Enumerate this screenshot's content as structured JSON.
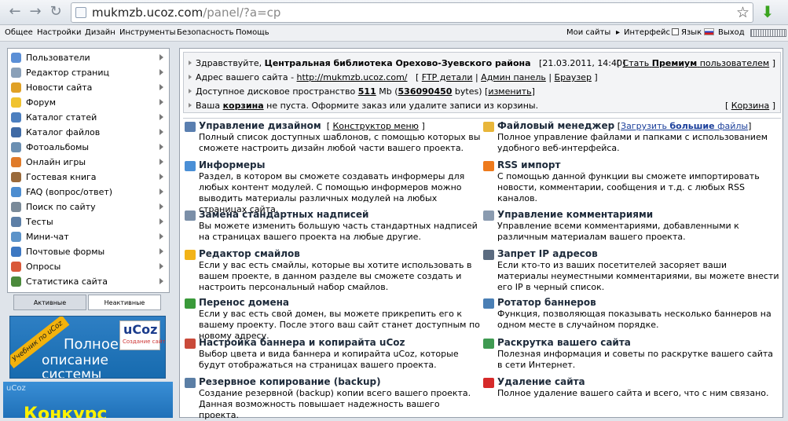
{
  "browser": {
    "url_host": "mukmzb.ucoz.com",
    "url_path": "/panel/?a=cp"
  },
  "menubar": {
    "items": [
      "Общее",
      "Настройки",
      "Дизайн",
      "Инструменты",
      "Безопасность",
      "Помощь"
    ],
    "right": {
      "my_sites": "Мои сайты",
      "interface": "Интерфейс",
      "language": "Язык",
      "logout": "Выход"
    }
  },
  "sidebar": {
    "items": [
      {
        "label": "Пользователи",
        "icon": "users-icon",
        "color": "#5b8fd6"
      },
      {
        "label": "Редактор страниц",
        "icon": "pages-icon",
        "color": "#8aa0b8"
      },
      {
        "label": "Новости сайта",
        "icon": "news-icon",
        "color": "#e0a126"
      },
      {
        "label": "Форум",
        "icon": "forum-icon",
        "color": "#f0c330"
      },
      {
        "label": "Каталог статей",
        "icon": "articles-icon",
        "color": "#4c7fbf"
      },
      {
        "label": "Каталог файлов",
        "icon": "files-icon",
        "color": "#3f6aa5"
      },
      {
        "label": "Фотоальбомы",
        "icon": "photo-icon",
        "color": "#6b8fb2"
      },
      {
        "label": "Онлайн игры",
        "icon": "games-icon",
        "color": "#e07b2a"
      },
      {
        "label": "Гостевая книга",
        "icon": "guestbook-icon",
        "color": "#9a6a3b"
      },
      {
        "label": "FAQ (вопрос/ответ)",
        "icon": "faq-icon",
        "color": "#4d8dd0"
      },
      {
        "label": "Поиск по сайту",
        "icon": "search-icon",
        "color": "#7a8a99"
      },
      {
        "label": "Тесты",
        "icon": "tests-icon",
        "color": "#5d7fa6"
      },
      {
        "label": "Мини-чат",
        "icon": "chat-icon",
        "color": "#5c93c9"
      },
      {
        "label": "Почтовые формы",
        "icon": "mail-icon",
        "color": "#3d78c2"
      },
      {
        "label": "Опросы",
        "icon": "polls-icon",
        "color": "#d9593a"
      },
      {
        "label": "Статистика сайта",
        "icon": "stats-icon",
        "color": "#4b8a3c"
      }
    ],
    "tabs": [
      "Активные",
      "Неактивные"
    ]
  },
  "banners": {
    "ribbon": "Учебник по uCoz",
    "line1": "Полное",
    "line2": "описание системы",
    "brand": "uCoz",
    "brand_sub": "Создание сайтов",
    "logo2": "uCoz",
    "big2": "Конкурс"
  },
  "info": {
    "greeting_prefix": "Здравствуйте,",
    "org_name": "Центральная библиотека Орехово-Зуевского района",
    "datetime": "[21.03.2011, 14:40]",
    "premium_open": "[",
    "premium_link": "Стать",
    "premium_word": "Премиум",
    "premium_rest": "пользователем",
    "premium_close": "]",
    "address_label": "Адрес вашего сайта -",
    "address_link": "http://mukmzb.ucoz.com/",
    "link_ftp": "FTP детали",
    "link_admin": "Админ панель",
    "link_browser": "Браузер",
    "disk_label": "Доступное дисковое пространство",
    "disk_mb": "511",
    "disk_unit": "Mb",
    "disk_bytes": "536090450",
    "disk_bytes_unit": "bytes)",
    "disk_change": "изменить",
    "cart_prefix": "Ваша",
    "cart_word": "корзина",
    "cart_rest": "не пуста. Оформите заказ или удалите записи из корзины.",
    "cart_link": "Корзина"
  },
  "modules_left": [
    {
      "title": "Управление дизайном",
      "link": "Конструктор меню",
      "desc": "Полный список доступных шаблонов, с помощью которых вы сможете настроить дизайн любой части вашего проекта.",
      "icon": "design-icon",
      "color": "#5a7fb0"
    },
    {
      "title": "Информеры",
      "desc": "Раздел, в котором вы сможете создавать информеры для любых контент модулей. С помощью информеров можно выводить материалы различных модулей на любых страницах сайта.",
      "icon": "informer-icon",
      "color": "#4a8fd6"
    },
    {
      "title": "Замена стандартных надписей",
      "desc": "Вы можете изменить большую часть стандартных надписей на страницах вашего проекта на любые другие.",
      "icon": "replace-icon",
      "color": "#7b8fa8"
    },
    {
      "title": "Редактор смайлов",
      "desc": "Если у вас есть смайлы, которые вы хотите использовать в вашем проекте, в данном разделе вы сможете создать и настроить персональный набор смайлов.",
      "icon": "smile-icon",
      "color": "#f2b318"
    },
    {
      "title": "Перенос домена",
      "desc": "Если у вас есть свой домен, вы можете прикрепить его к вашему проекту. После этого ваш сайт станет доступным по новому адресу.",
      "icon": "domain-icon",
      "color": "#3a9a3a"
    },
    {
      "title": "Настройка баннера и копирайта uCoz",
      "desc": "Выбор цвета и вида баннера и копирайта uCoz, которые будут отображаться на страницах вашего проекта.",
      "icon": "banner-icon",
      "color": "#c94a3a"
    },
    {
      "title": "Резервное копирование (backup)",
      "desc": "Создание резервной (backup) копии всего вашего проекта. Данная возможность повышает надежность вашего проекта.",
      "icon": "backup-icon",
      "color": "#5b7ea5"
    }
  ],
  "modules_right": [
    {
      "title": "Файловый менеджер",
      "link_pre": "Загрузить",
      "link_bold": "большие",
      "link_post": "файлы",
      "desc": "Полное управление файлами и папками с использованием удобного веб-интерфейса.",
      "icon": "folder-icon",
      "color": "#e8b63a"
    },
    {
      "title": "RSS импорт",
      "desc": "С помощью данной функции вы сможете импортировать новости, комментарии, сообщения и т.д. с любых RSS каналов.",
      "icon": "rss-icon",
      "color": "#ee7a1c"
    },
    {
      "title": "Управление комментариями",
      "desc": "Управление всеми комментариями, добавленными к различным материалам вашего проекта.",
      "icon": "comments-icon",
      "color": "#8a9bb0"
    },
    {
      "title": "Запрет IP адресов",
      "desc": "Если кто-то из ваших посетителей засоряет ваши материалы неуместными комментариями, вы можете внести его IP в черный список.",
      "icon": "ban-icon",
      "color": "#5a6b80"
    },
    {
      "title": "Ротатор баннеров",
      "desc": "Функция, позволяющая показывать несколько баннеров на одном месте в случайном порядке.",
      "icon": "rotator-icon",
      "color": "#4a7fb5"
    },
    {
      "title": "Раскрутка вашего сайта",
      "desc": "Полезная информация и советы по раскрутке вашего сайта в сети Интернет.",
      "icon": "promo-icon",
      "color": "#3f9a52"
    },
    {
      "title": "Удаление сайта",
      "desc": "Полное удаление вашего сайта и всего, что с ним связано.",
      "icon": "delete-icon",
      "color": "#d62a2a"
    }
  ]
}
